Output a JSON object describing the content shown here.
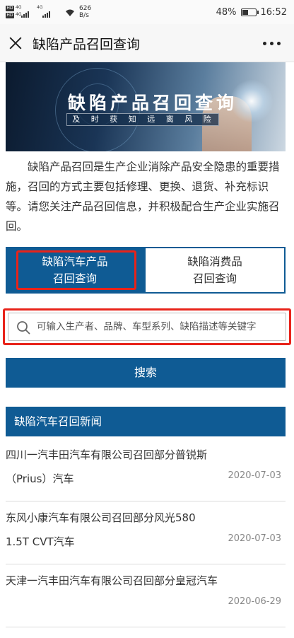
{
  "status_bar": {
    "network_left_1": "4G",
    "network_left_2": "4G",
    "network_right": "4G",
    "net_speed_value": "626",
    "net_speed_unit": "B/s",
    "battery": "48%",
    "battery_level": 0.48,
    "time": "16:52"
  },
  "nav": {
    "title": "缺陷产品召回查询",
    "close_icon": "close-icon",
    "more_icon": "more-icon"
  },
  "banner": {
    "title": "缺陷产品召回查询",
    "subtitle": "及 时 获 知     远 离 风 险"
  },
  "intro": "缺陷产品召回是生产企业消除产品安全隐患的重要措施，召回的方式主要包括修理、更换、退货、补充标识等。请您关注产品召回信息，并积极配合生产企业实施召回。",
  "tabs": [
    {
      "line1": "缺陷汽车产品",
      "line2": "召回查询",
      "active": true
    },
    {
      "line1": "缺陷消费品",
      "line2": "召回查询",
      "active": false
    }
  ],
  "search": {
    "placeholder": "可输入生产者、品牌、车型系列、缺陷描述等关键字",
    "value": "",
    "button_label": "搜索"
  },
  "news": {
    "header": "缺陷汽车召回新闻",
    "items": [
      {
        "title": "四川一汽丰田汽车有限公司召回部分普锐斯（Prius）汽车",
        "date": "2020-07-03"
      },
      {
        "title": "东风小康汽车有限公司召回部分风光580 1.5T CVT汽车",
        "date": "2020-07-03"
      },
      {
        "title": "天津一汽丰田汽车有限公司召回部分皇冠汽车",
        "date": "2020-06-29"
      }
    ]
  },
  "colors": {
    "accent": "#0f5b94",
    "highlight": "#e8231a"
  }
}
